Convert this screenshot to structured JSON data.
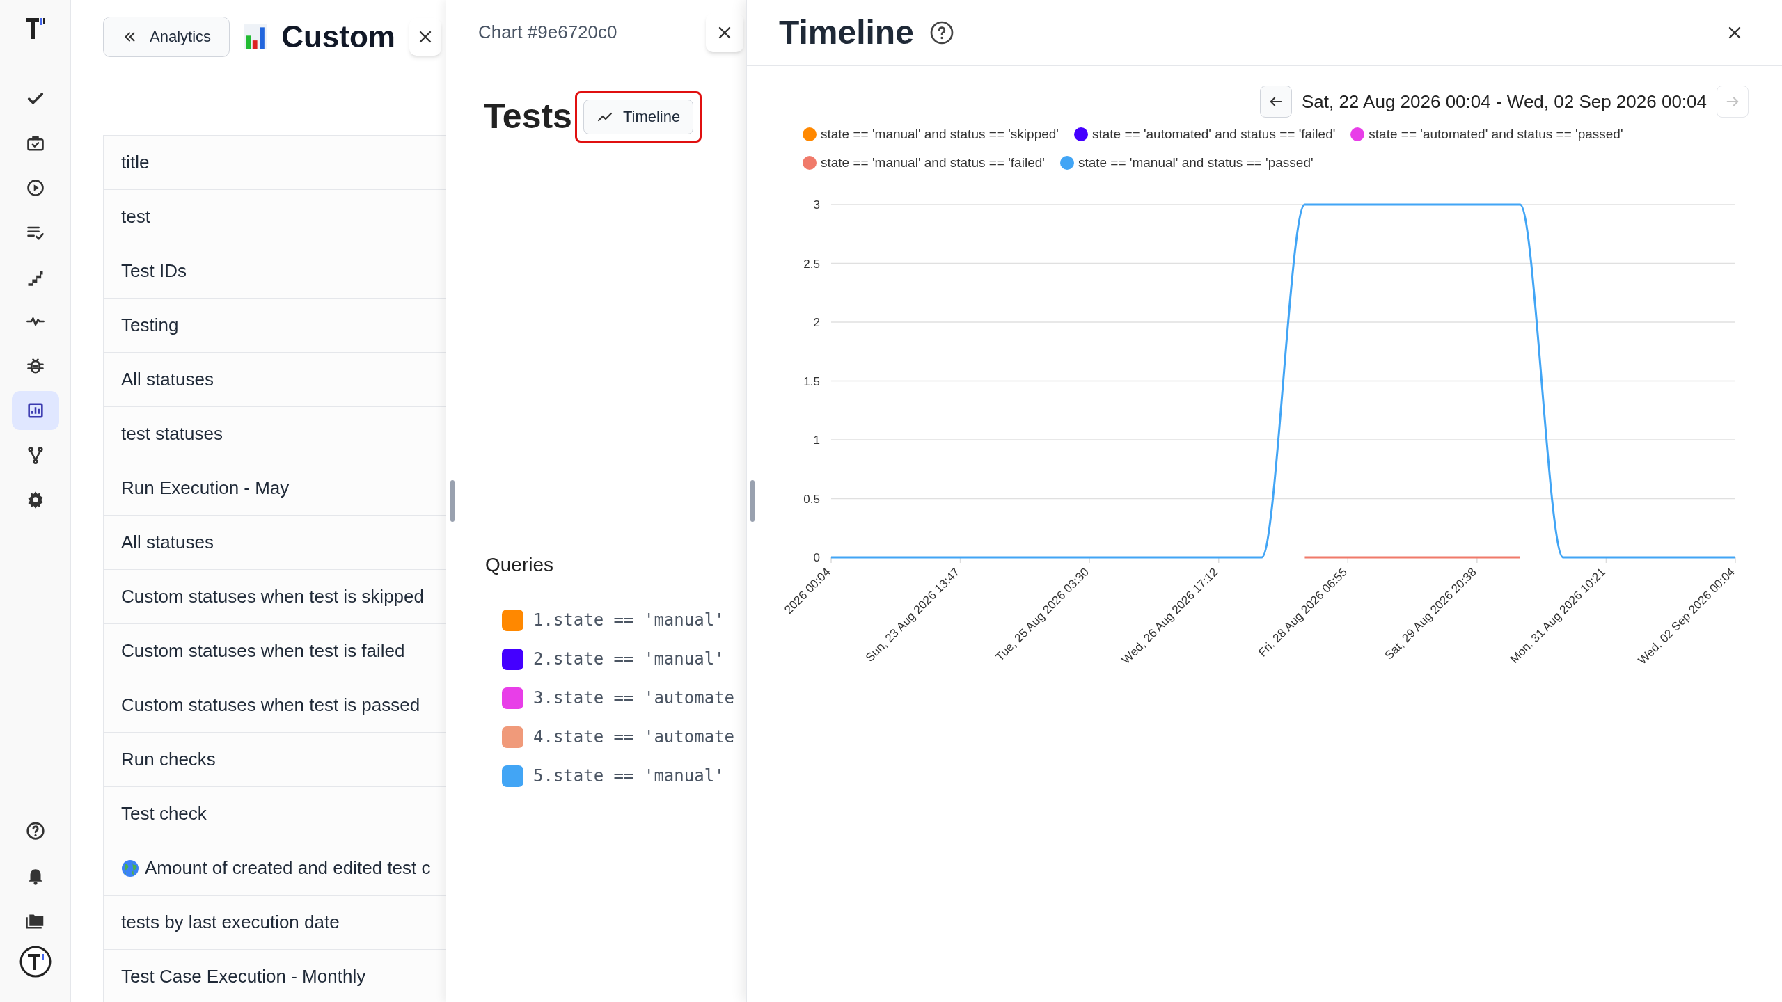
{
  "rail": {
    "items": [
      {
        "selected": false
      },
      {
        "selected": false
      },
      {
        "selected": false
      },
      {
        "selected": false
      },
      {
        "selected": false
      },
      {
        "selected": false
      },
      {
        "selected": false
      },
      {
        "selected": true
      },
      {
        "selected": false
      },
      {
        "selected": false
      }
    ]
  },
  "list_panel": {
    "back_button": "Analytics",
    "title": "Custom",
    "items": [
      {
        "label": "title",
        "kind": "plain"
      },
      {
        "label": "test",
        "kind": "plain"
      },
      {
        "label": "Test IDs",
        "kind": "plain"
      },
      {
        "label": "Testing",
        "kind": "plain"
      },
      {
        "label": "All statuses",
        "kind": "plain"
      },
      {
        "label": "test statuses",
        "kind": "plain"
      },
      {
        "label": "Run Execution - May",
        "kind": "plain"
      },
      {
        "label": "All statuses",
        "kind": "plain"
      },
      {
        "label": "Custom statuses when test is skipped",
        "kind": "plain"
      },
      {
        "label": "Custom statuses when test is failed",
        "kind": "plain"
      },
      {
        "label": "Custom statuses when test is passed",
        "kind": "plain"
      },
      {
        "label": "Run checks",
        "kind": "plain"
      },
      {
        "label": "Test check",
        "kind": "plain"
      },
      {
        "label": "Amount of created and edited test c",
        "kind": "globe"
      },
      {
        "label": "tests by last execution date",
        "kind": "plain"
      },
      {
        "label": "Test Case Execution - Monthly",
        "kind": "plain"
      }
    ]
  },
  "chart_panel": {
    "title": "Chart #9e6720c0",
    "name": "Tests",
    "type_button": "Timeline",
    "queries_heading": "Queries",
    "queries": [
      {
        "text": "1.state == 'manual'",
        "color": "#ff8800"
      },
      {
        "text": "2.state == 'manual'",
        "color": "#4400ff"
      },
      {
        "text": "3.state == 'automate",
        "color": "#e83ee8"
      },
      {
        "text": "4.state == 'automate",
        "color": "#f09a7a"
      },
      {
        "text": "5.state == 'manual'",
        "color": "#42a5f5"
      }
    ]
  },
  "timeline": {
    "title": "Timeline",
    "prev_button": {
      "disabled": false
    },
    "range": "Sat, 22 Aug 2026 00:04 - Wed, 02 Sep 2026 00:04",
    "next_button": {
      "disabled": true
    },
    "chart_data": {
      "type": "line",
      "categories": [
        "2026 00:04",
        null,
        null,
        "Sun, 23 Aug 2026 13:47",
        null,
        null,
        "Tue, 25 Aug 2026 03:30",
        null,
        null,
        "Wed, 26 Aug 2026 17:12",
        null,
        null,
        "Fri, 28 Aug 2026 06:55",
        null,
        null,
        "Sat, 29 Aug 2026 20:38",
        null,
        null,
        "Mon, 31 Aug 2026 10:21",
        null,
        null,
        "Wed, 02 Sep 2026 00:04"
      ],
      "series": [
        {
          "name": "state == 'manual' and status == 'skipped'",
          "color": "#ff8800",
          "values": [
            null,
            null,
            null,
            null,
            null,
            null,
            null,
            null,
            null,
            null,
            null,
            null,
            null,
            null,
            null,
            null,
            null,
            null,
            null,
            null,
            null,
            null
          ]
        },
        {
          "name": "state == 'automated' and status == 'failed'",
          "color": "#4400ff",
          "values": [
            null,
            null,
            null,
            null,
            null,
            null,
            null,
            null,
            null,
            null,
            null,
            null,
            null,
            null,
            null,
            null,
            null,
            null,
            null,
            null,
            null,
            null
          ]
        },
        {
          "name": "state == 'automated' and status == 'passed'",
          "color": "#e83ee8",
          "values": [
            null,
            null,
            null,
            null,
            null,
            null,
            null,
            null,
            null,
            null,
            null,
            null,
            null,
            null,
            null,
            null,
            null,
            null,
            null,
            null,
            null,
            null
          ]
        },
        {
          "name": "state == 'manual' and status == 'failed'",
          "color": "#f07a6a",
          "values": [
            null,
            null,
            null,
            null,
            null,
            null,
            null,
            null,
            null,
            null,
            null,
            0,
            0,
            0,
            0,
            0,
            0,
            null,
            null,
            null,
            null,
            null
          ]
        },
        {
          "name": "state == 'manual' and status == 'passed'",
          "color": "#42a5f5",
          "values": [
            0,
            0,
            0,
            0,
            0,
            0,
            0,
            0,
            0,
            0,
            0,
            3,
            3,
            3,
            3,
            3,
            3,
            0,
            0,
            0,
            0,
            0
          ]
        }
      ],
      "ylim": [
        0,
        3
      ],
      "grid": true,
      "legend": "top",
      "yticks": [
        0,
        0.5,
        1,
        1.5,
        2,
        2.5,
        3
      ]
    }
  }
}
